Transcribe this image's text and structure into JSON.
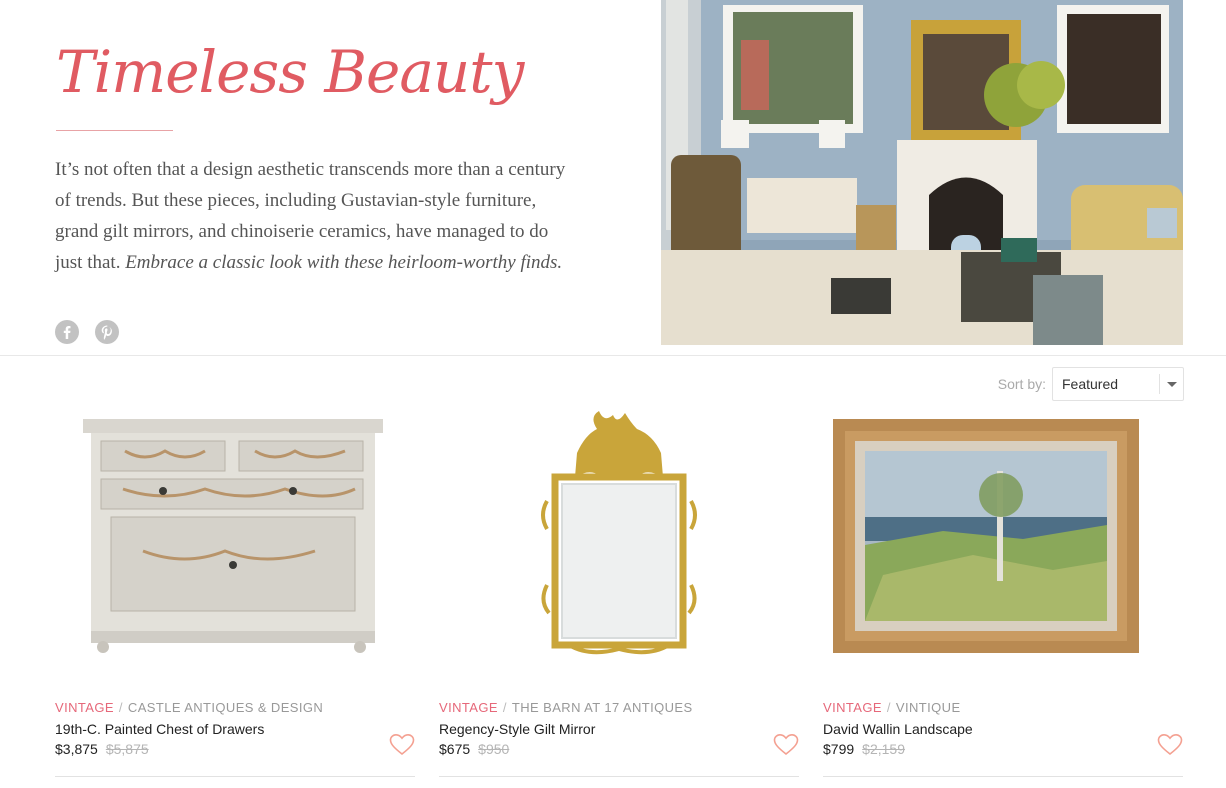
{
  "hero": {
    "title": "Timeless Beauty",
    "body": "It’s not often that a design aesthetic transcends more than a century of trends. But these pieces, including Gustavian-style furniture, grand gilt mirrors, and chinoiserie ceramics, have managed to do just that.",
    "body_emphasis": "Embrace a classic look with these heirloom-worthy finds.",
    "social_icons": [
      "facebook-icon",
      "pinterest-icon"
    ]
  },
  "sort": {
    "label": "Sort by:",
    "selected": "Featured"
  },
  "products": [
    {
      "category": "VINTAGE",
      "seller": "CASTLE ANTIQUES & DESIGN",
      "name": "19th-C. Painted Chest of Drawers",
      "price": "$3,875",
      "original_price": "$5,875"
    },
    {
      "category": "VINTAGE",
      "seller": "THE BARN AT 17 ANTIQUES",
      "name": "Regency-Style Gilt Mirror",
      "price": "$675",
      "original_price": "$950"
    },
    {
      "category": "VINTAGE",
      "seller": "VINTIQUE",
      "name": "David Wallin Landscape",
      "price": "$799",
      "original_price": "$2,159"
    }
  ],
  "colors": {
    "accent": "#e05b62",
    "category": "#e6687a",
    "heart": "#f4a091"
  }
}
